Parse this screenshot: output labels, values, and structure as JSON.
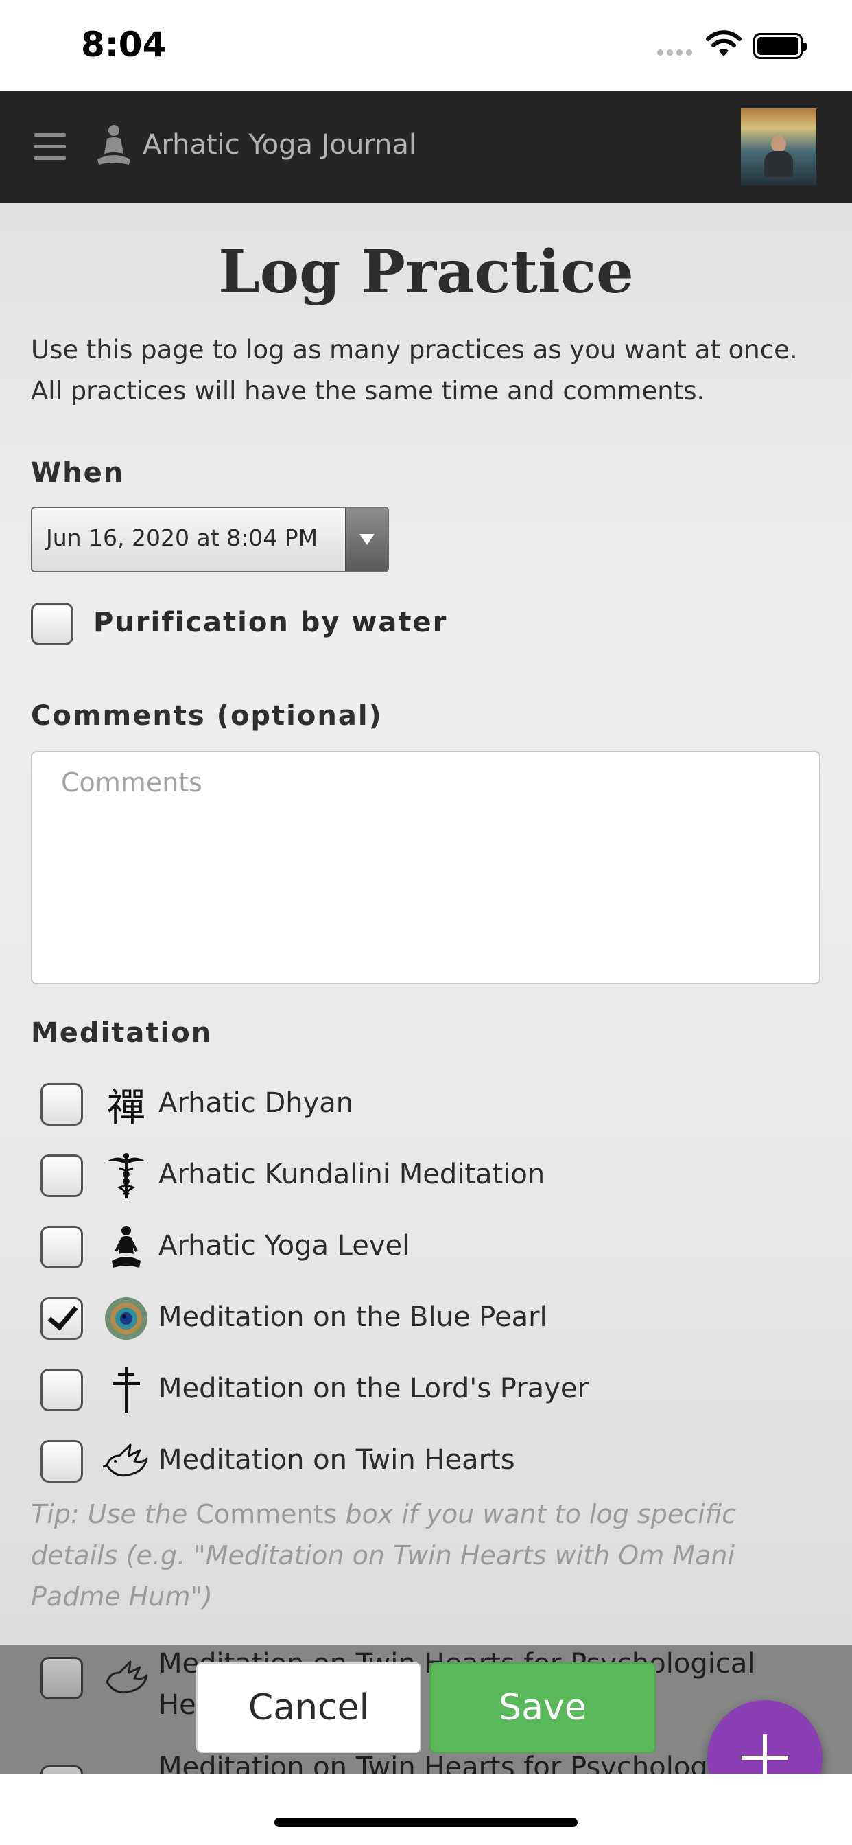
{
  "status_bar": {
    "time": "8:04"
  },
  "app_bar": {
    "title": "Arhatic Yoga Journal"
  },
  "page": {
    "title": "Log Practice",
    "intro": "Use this page to log as many practices as you want at once. All practices will have the same time and comments."
  },
  "when": {
    "label": "When",
    "value": "Jun 16, 2020 at 8:04 PM"
  },
  "purification": {
    "label": "Purification by water",
    "checked": false
  },
  "comments": {
    "label": "Comments (optional)",
    "placeholder": "Comments"
  },
  "meditation": {
    "label": "Meditation",
    "items": [
      {
        "label": "Arhatic Dhyan",
        "icon": "zen-kanji-icon",
        "checked": false
      },
      {
        "label": "Arhatic Kundalini Meditation",
        "icon": "caduceus-icon",
        "checked": false
      },
      {
        "label": "Arhatic Yoga Level",
        "icon": "meditating-figure-icon",
        "checked": false
      },
      {
        "label": "Meditation on the Blue Pearl",
        "icon": "blue-pearl-icon",
        "checked": true
      },
      {
        "label": "Meditation on the Lord's Prayer",
        "icon": "cross-icon",
        "checked": false
      },
      {
        "label": "Meditation on Twin Hearts",
        "icon": "dove-icon",
        "checked": false
      }
    ],
    "hidden_items": [
      {
        "label": "Meditation on Twin Hearts for Psychological He",
        "icon": "dove-icon",
        "checked": false
      },
      {
        "label": "Meditation on Twin Hearts for Psychologi",
        "icon": "dove-icon",
        "checked": false
      }
    ]
  },
  "tip": {
    "prefix": "Tip: Use the",
    "emphasis": "Comments",
    "suffix": "box if you want to log specific details (e.g. \"Meditation on Twin Hearts with Om Mani Padme Hum\")"
  },
  "actions": {
    "cancel": "Cancel",
    "save": "Save"
  },
  "colors": {
    "app_bar": "#252525",
    "save": "#59b85a",
    "fab": "#8a3fb4"
  }
}
